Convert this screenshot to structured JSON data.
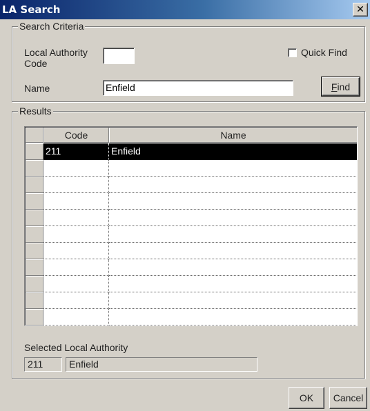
{
  "window": {
    "title": "LA Search",
    "close_glyph": "✕"
  },
  "search_criteria": {
    "legend": "Search Criteria",
    "la_code_label": "Local Authority Code",
    "la_code_value": "",
    "quick_find_label": "Quick Find",
    "quick_find_checked": false,
    "name_label": "Name",
    "name_value": "Enfield",
    "find_button": {
      "prefix": "",
      "mnemonic": "F",
      "suffix": "ind"
    }
  },
  "results": {
    "legend": "Results",
    "columns": [
      "Code",
      "Name"
    ],
    "rows": [
      {
        "code": "211",
        "name": "Enfield",
        "selected": true
      },
      {
        "code": "",
        "name": ""
      },
      {
        "code": "",
        "name": ""
      },
      {
        "code": "",
        "name": ""
      },
      {
        "code": "",
        "name": ""
      },
      {
        "code": "",
        "name": ""
      },
      {
        "code": "",
        "name": ""
      },
      {
        "code": "",
        "name": ""
      },
      {
        "code": "",
        "name": ""
      },
      {
        "code": "",
        "name": ""
      },
      {
        "code": "",
        "name": ""
      }
    ]
  },
  "selected": {
    "label": "Selected Local Authority",
    "code": "211",
    "name": "Enfield"
  },
  "buttons": {
    "ok": "OK",
    "cancel": "Cancel"
  }
}
